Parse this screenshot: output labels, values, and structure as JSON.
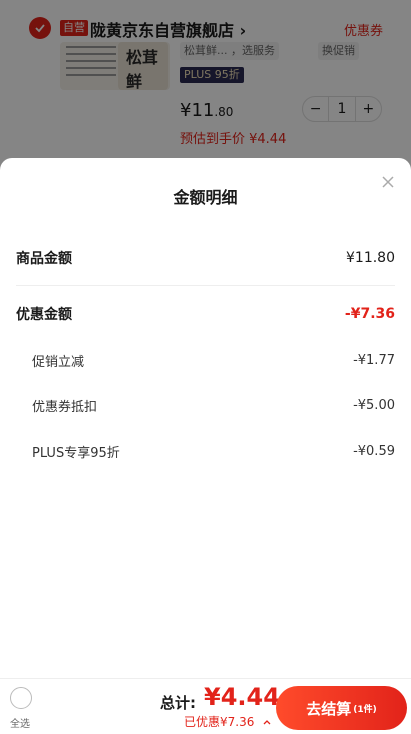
{
  "background": {
    "store_badge": "自营",
    "store_name": "陇黄京东自营旗舰店",
    "coupon_link": "优惠券",
    "sku_option": "松茸鲜...  ，选服务",
    "sku_option_2": "换促销",
    "plus_tag": "PLUS 95折",
    "price_main": "¥11",
    "price_decimal": ".80",
    "estimated_price": "预估到手价 ¥4.44",
    "quantity": "1",
    "decrement": "−",
    "increment": "+",
    "thumb_text": "松茸鲜"
  },
  "sheet": {
    "title": "金额明细",
    "rows": [
      {
        "label": "商品金额",
        "value": "¥11.80"
      },
      {
        "label": "优惠金额",
        "value": "-¥7.36"
      }
    ],
    "sub_rows": [
      {
        "label": "促销立减",
        "value": "-¥1.77"
      },
      {
        "label": "优惠券抵扣",
        "value": "-¥5.00"
      },
      {
        "label": "PLUS专享95折",
        "value": "-¥0.59"
      }
    ]
  },
  "bottom": {
    "select_all": "全选",
    "total_label": "总计:",
    "total_value": "¥4.44",
    "saved": "已优惠¥7.36",
    "checkout": "去结算",
    "checkout_count": "(1件)"
  },
  "colors": {
    "accent": "#e2231a",
    "plus_bg": "#2b2b54"
  }
}
